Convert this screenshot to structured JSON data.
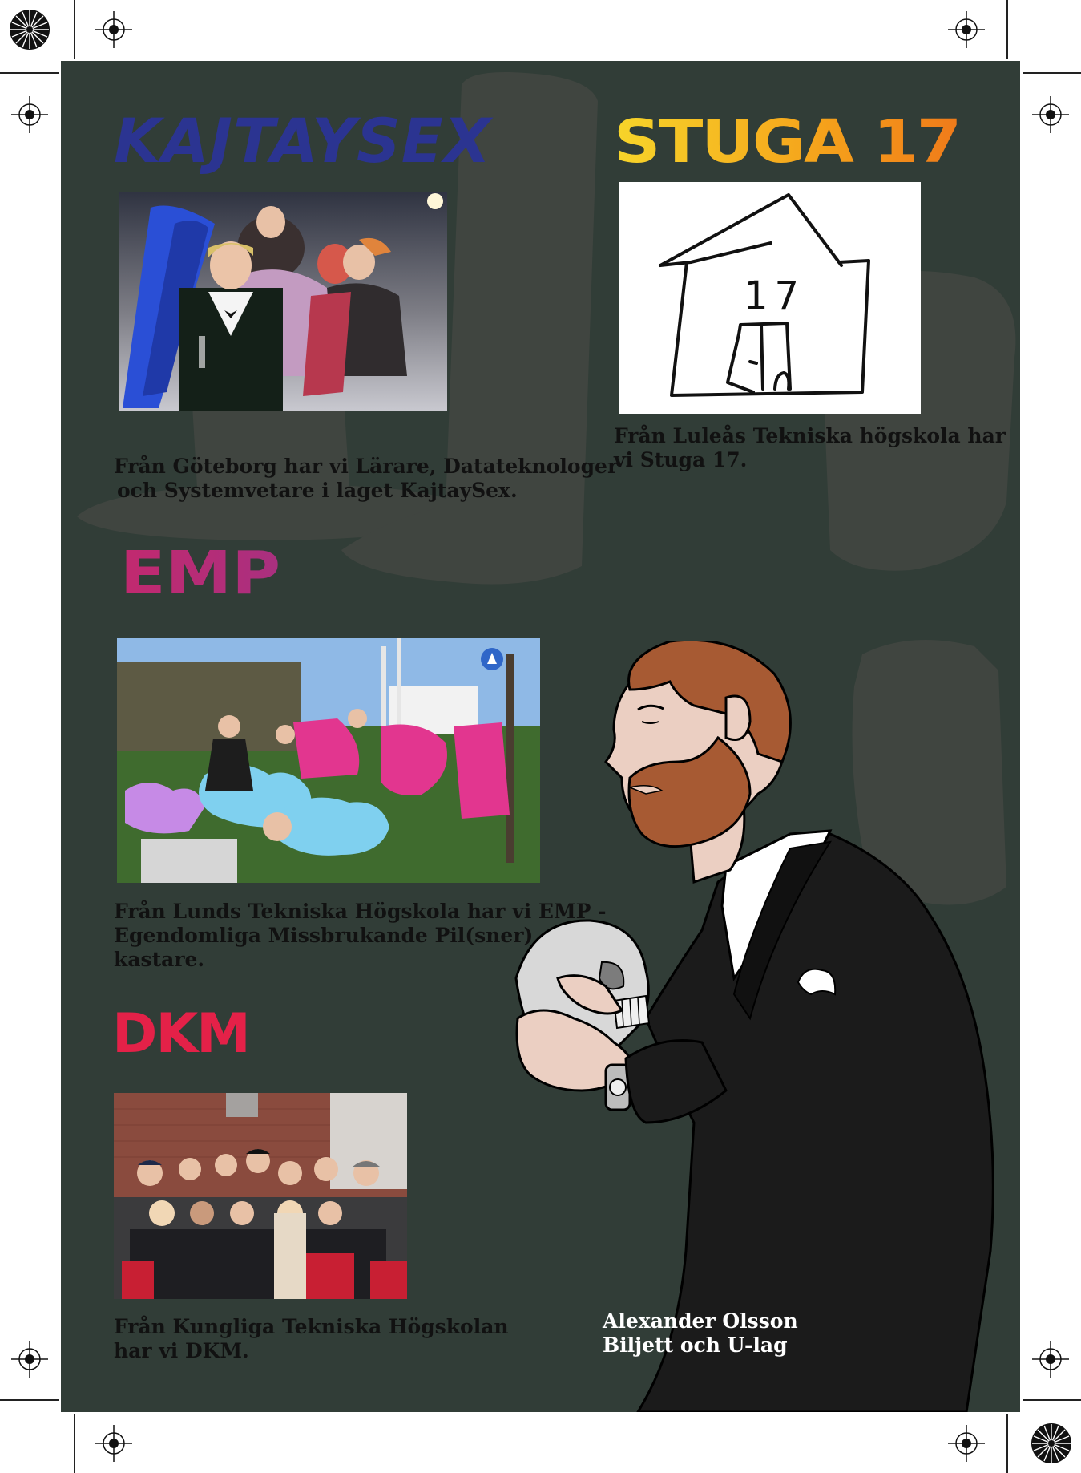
{
  "colors": {
    "panel_bg": "#313d37",
    "kajtaysex": "#2b3491",
    "stuga_gradient": [
      "#f7d52a",
      "#f5a21b",
      "#ef7a1a"
    ],
    "emp_gradient": [
      "#c2296f",
      "#a9307f"
    ],
    "dkm": "#e42148",
    "caption_text": "#111111",
    "credit_text": "#ffffff"
  },
  "teams": [
    {
      "title": "KAJTAYSEX",
      "photo": "team-kajtaysex-group-photo",
      "caption": [
        "Från Göteborg har vi Lärare, Datateknologer",
        "och Systemvetare i laget KajtaySex."
      ]
    },
    {
      "title": "STUGA 17",
      "photo": "house-drawing",
      "house_number": "17",
      "caption": [
        "Från Luleås Tekniska högskola har",
        "vi Stuga 17."
      ]
    },
    {
      "title": "EMP",
      "photo": "team-emp-group-photo",
      "caption": [
        "Från Lunds Tekniska Högskola har vi EMP -",
        "Egendomliga Missbrukande Pil(sner)",
        "kastare."
      ]
    },
    {
      "title": "DKM",
      "photo": "team-dkm-group-photo",
      "caption": [
        "Från Kungliga Tekniska Högskolan",
        "har vi DKM."
      ]
    }
  ],
  "illustration": "man-in-suit-holding-skull",
  "credit": {
    "name": "Alexander Olsson",
    "role": "Biljett och U-lag"
  }
}
